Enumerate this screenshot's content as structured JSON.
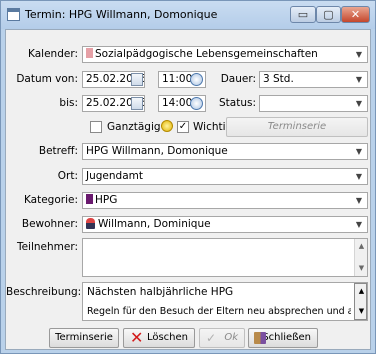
{
  "window": {
    "title": "Termin: HPG Willmann, Domonique",
    "min_glyph": "▭",
    "max_glyph": "▢",
    "close_glyph": "✕"
  },
  "form": {
    "kalender": {
      "label": "Kalender:",
      "value": "Sozialpädgogische Lebensgemeinschaften",
      "color": "#e6a0a6"
    },
    "datum_von": {
      "label": "Datum von:",
      "date": "25.02.2016",
      "time": "11:00"
    },
    "dauer": {
      "label": "Dauer:",
      "value": "3 Std."
    },
    "bis": {
      "label": "bis:",
      "date": "25.02.2016",
      "time": "14:00"
    },
    "status": {
      "label": "Status:",
      "value": ""
    },
    "ganztaegig": {
      "label": "Ganztägig",
      "checked": false
    },
    "wichtig": {
      "label": "Wichtig",
      "checked": true,
      "check_glyph": "✓"
    },
    "terminserie_top": {
      "label": "Terminserie"
    },
    "betreff": {
      "label": "Betreff:",
      "value": "HPG Willmann, Domonique"
    },
    "ort": {
      "label": "Ort:",
      "value": "Jugendamt"
    },
    "kategorie": {
      "label": "Kategorie:",
      "value": "HPG",
      "color": "#6a1a6f"
    },
    "bewohner": {
      "label": "Bewohner:",
      "value": "Willmann, Dominique"
    },
    "teilnehmer": {
      "label": "Teilnehmer:",
      "value": ""
    },
    "beschreibung": {
      "label": "Beschreibung:",
      "line1": "Nächsten halbjährliche HPG",
      "line2": "Regeln für den Besuch der Eltern neu absprechen und auf Einhltung der"
    }
  },
  "buttons": {
    "terminserie": "Terminserie",
    "loeschen": "Löschen",
    "ok": "Ok",
    "schliessen": "Schließen"
  },
  "glyphs": {
    "dropdown": "▼",
    "up": "▲",
    "down": "▼"
  }
}
